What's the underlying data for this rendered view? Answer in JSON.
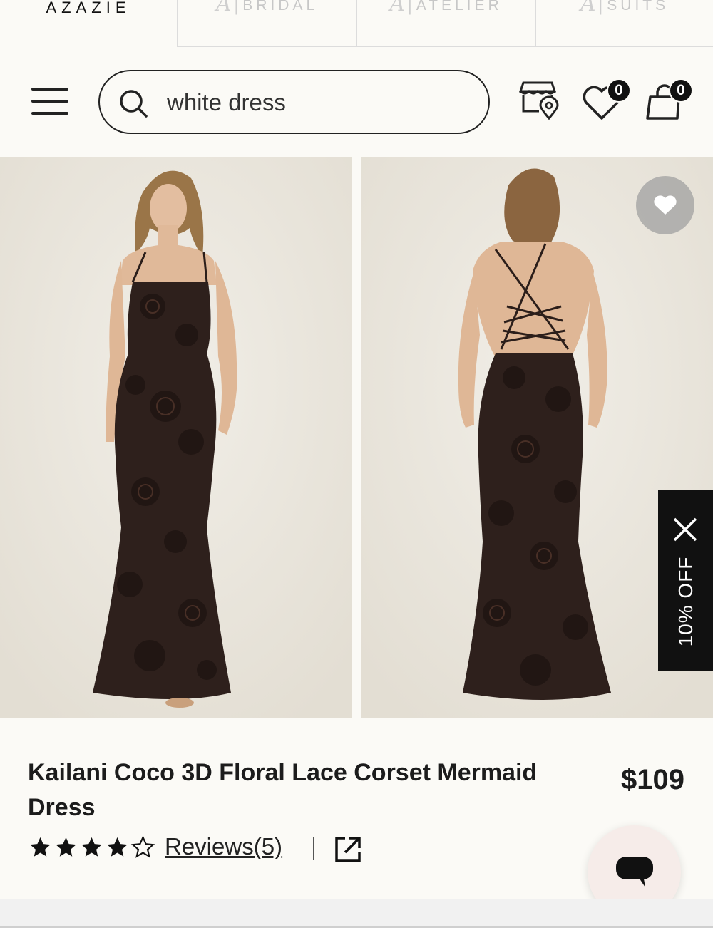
{
  "brand": {
    "logo_text": "AZAZIE"
  },
  "subtabs": [
    {
      "label": "BRIDAL"
    },
    {
      "label": "ATELIER"
    },
    {
      "label": "SUITS"
    }
  ],
  "header": {
    "search_value": "white dress",
    "wishlist_count": "0",
    "cart_count": "0",
    "icons": [
      "menu-icon",
      "search-icon",
      "store-locator-icon",
      "heart-icon",
      "cart-icon"
    ]
  },
  "promo": {
    "discount_label": "10% OFF"
  },
  "product": {
    "title": "Kailani Coco 3D Floral Lace Corset Mermaid Dress",
    "price": "$109",
    "rating": 4,
    "rating_max": 5,
    "reviews_label": "Reviews(5)"
  },
  "colors": {
    "dress": "#2e201c",
    "background": "#fbfaf6",
    "image_bg": "#ece8df"
  }
}
